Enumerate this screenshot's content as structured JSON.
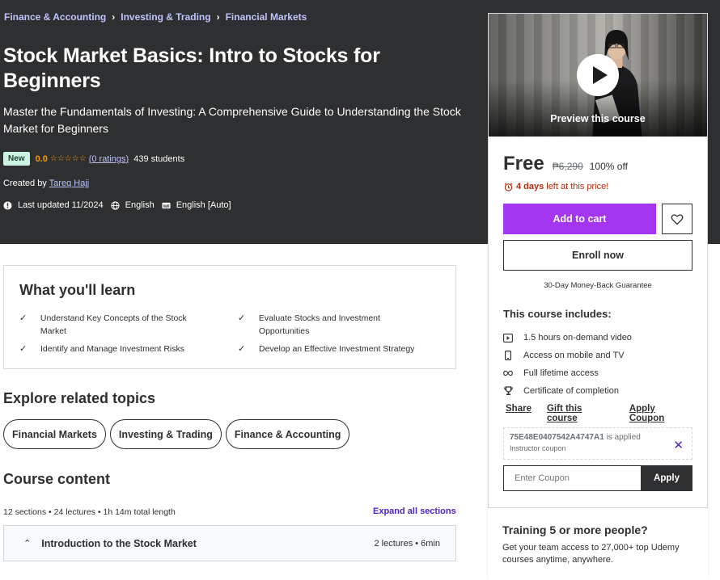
{
  "breadcrumb": [
    "Finance & Accounting",
    "Investing & Trading",
    "Financial Markets"
  ],
  "course": {
    "title": "Stock Market Basics: Intro to Stocks for Beginners",
    "subtitle": "Master the Fundamentals of Investing: A Comprehensive Guide to Understanding the Stock Market for Beginners",
    "badge": "New",
    "rating": "0.0",
    "rating_stars": "☆☆☆☆☆",
    "ratings_count": "(0 ratings)",
    "students": "439 students",
    "created_by_label": "Created by",
    "instructor": "Tareq Hajj",
    "last_updated": "Last updated 11/2024",
    "language": "English",
    "captions": "English [Auto]"
  },
  "sidebar": {
    "preview_label": "Preview this course",
    "price": "Free",
    "original_price": "₱6,290",
    "discount": "100% off",
    "timer_prefix_icon": "alarm-icon",
    "timer_bold": "4 days",
    "timer_rest": "left at this price!",
    "add_to_cart": "Add to cart",
    "enroll_now": "Enroll now",
    "guarantee": "30-Day Money-Back Guarantee",
    "includes_title": "This course includes:",
    "includes": [
      {
        "icon": "video-icon",
        "text": "1.5 hours on-demand video"
      },
      {
        "icon": "mobile-icon",
        "text": "Access on mobile and TV"
      },
      {
        "icon": "infinity-icon",
        "text": "Full lifetime access"
      },
      {
        "icon": "trophy-icon",
        "text": "Certificate of completion"
      }
    ],
    "share": "Share",
    "gift": "Gift this course",
    "apply_coupon": "Apply Coupon",
    "coupon_code": "75E48E0407542A4747A1",
    "coupon_applied": "is applied",
    "coupon_type": "Instructor coupon",
    "coupon_placeholder": "Enter Coupon",
    "coupon_apply": "Apply",
    "team_title": "Training 5 or more people?",
    "team_desc": "Get your team access to 27,000+ top Udemy courses anytime, anywhere."
  },
  "learn": {
    "heading": "What you'll learn",
    "items": [
      "Understand Key Concepts of the Stock Market",
      "Evaluate Stocks and Investment Opportunities",
      "Identify and Manage Investment Risks",
      "Develop an Effective Investment Strategy"
    ]
  },
  "related": {
    "heading": "Explore related topics",
    "topics": [
      "Financial Markets",
      "Investing & Trading",
      "Finance & Accounting"
    ]
  },
  "content": {
    "heading": "Course content",
    "meta": "12 sections • 24 lectures • 1h 14m total length",
    "expand_all": "Expand all sections",
    "first_section": {
      "title": "Introduction to the Stock Market",
      "info": "2 lectures • 6min"
    }
  },
  "colors": {
    "hero_bg": "#2d2f31",
    "accent": "#a435f0",
    "link": "#c0c4fc",
    "rating": "#f69c08",
    "timer": "#b32d0f",
    "purple_text": "#5022c3"
  }
}
